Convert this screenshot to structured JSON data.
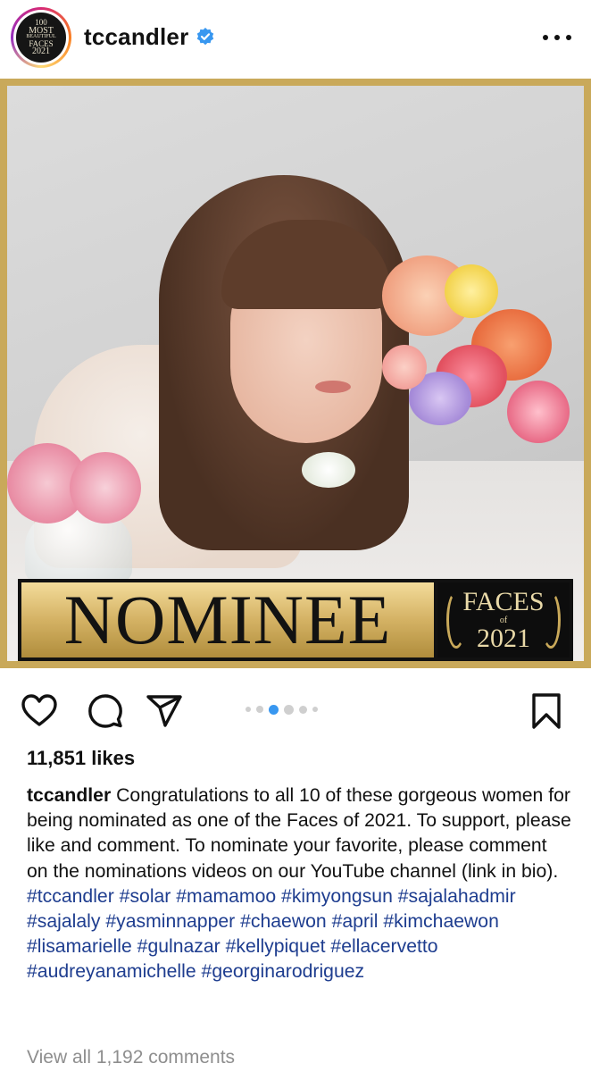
{
  "header": {
    "username": "tccandler",
    "avatar_text": [
      "100",
      "MOST",
      "BEAUTIFUL",
      "FACES",
      "2021"
    ],
    "verified_icon": "verified-badge-icon",
    "more_icon": "more-options-icon"
  },
  "post_image": {
    "banner_text": "NOMINEE",
    "badge_faces": "FACES",
    "badge_of": "of",
    "badge_year": "2021"
  },
  "actions": {
    "like_icon": "heart-icon",
    "comment_icon": "comment-icon",
    "share_icon": "share-icon",
    "save_icon": "bookmark-icon",
    "carousel_count": 6,
    "carousel_active": 2
  },
  "likes": "11,851 likes",
  "caption": {
    "username": "tccandler",
    "text": "Congratulations to all 10 of these gorgeous women for being nominated as one of the Faces of 2021.  To support, please like and comment.  To nominate your favorite,  please comment on the nominations videos on our YouTube channel (link in bio).",
    "hashtags": [
      "#tccandler",
      "#solar",
      "#mamamoo",
      "#kimyongsun",
      "#sajalahadmir",
      "#sajalaly",
      "#yasminnapper",
      "#chaewon",
      "#april",
      "#kimchaewon",
      "#lisamarielle",
      "#gulnazar",
      "#kellypiquet",
      "#ellacervetto",
      "#audreyanamichelle",
      "#georginarodriguez"
    ]
  },
  "view_all_comments": "View all 1,192 comments",
  "colors": {
    "hashtag": "#1e3d8f",
    "verified": "#3897f0",
    "carousel_active": "#3897f0",
    "muted": "#8e8e8e",
    "gold": "#c9a95a"
  }
}
